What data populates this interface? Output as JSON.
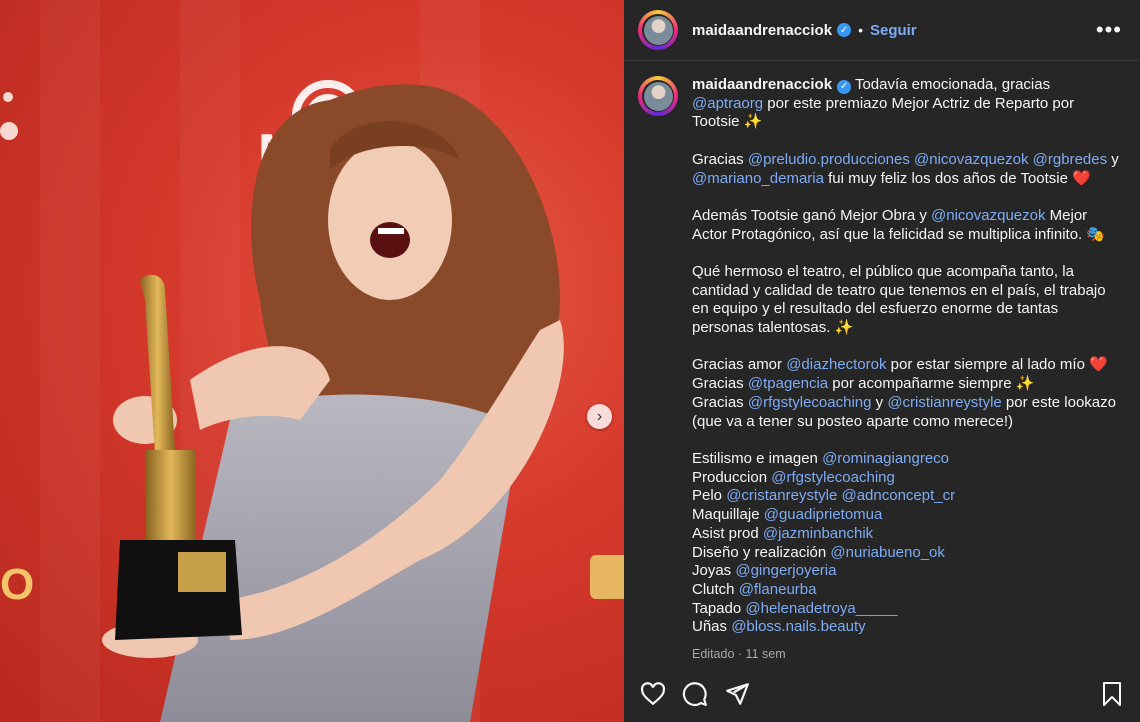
{
  "post": {
    "username": "maidaandrenacciok",
    "follow_label": "Seguir",
    "more_label": "•••",
    "next_label": "›"
  },
  "media": {
    "background_logo_text": "Ma",
    "side_logo_text": "O"
  },
  "caption": {
    "username": "maidaandrenacciok",
    "paragraphs": [
      [
        {
          "t": "Todavía emocionada, gracias "
        },
        {
          "t": "@aptraorg",
          "m": true
        },
        {
          "t": " por este premiazo Mejor Actriz de Reparto por Tootsie ✨"
        }
      ],
      [
        {
          "t": "Gracias "
        },
        {
          "t": "@preludio.producciones",
          "m": true
        },
        {
          "t": " "
        },
        {
          "t": "@nicovazquezok",
          "m": true
        },
        {
          "t": " "
        },
        {
          "t": "@rgbredes",
          "m": true
        },
        {
          "t": " y "
        },
        {
          "t": "@mariano_demaria",
          "m": true
        },
        {
          "t": " fui muy feliz los dos años de Tootsie ❤️"
        }
      ],
      [
        {
          "t": "Además Tootsie ganó Mejor Obra y "
        },
        {
          "t": "@nicovazquezok",
          "m": true
        },
        {
          "t": " Mejor Actor Protagónico, así que la felicidad se multiplica infinito. 🎭"
        }
      ],
      [
        {
          "t": "Qué hermoso el teatro, el público que acompaña tanto, la cantidad y calidad de teatro que tenemos en el país, el trabajo en equipo y el resultado del esfuerzo enorme de tantas personas talentosas. ✨"
        }
      ],
      [
        {
          "t": "Gracias amor "
        },
        {
          "t": "@diazhectorok",
          "m": true
        },
        {
          "t": " por estar siempre al lado mío ❤️"
        },
        {
          "br": true
        },
        {
          "t": "Gracias "
        },
        {
          "t": "@tpagencia",
          "m": true
        },
        {
          "t": " por acompañarme siempre ✨"
        },
        {
          "br": true
        },
        {
          "t": "Gracias "
        },
        {
          "t": "@rfgstylecoaching",
          "m": true
        },
        {
          "t": " y "
        },
        {
          "t": "@cristianreystyle",
          "m": true
        },
        {
          "t": " por este lookazo (que va a tener su posteo aparte como merece!)"
        }
      ],
      [
        {
          "t": "Estilismo e imagen "
        },
        {
          "t": "@rominagiangreco",
          "m": true
        },
        {
          "br": true
        },
        {
          "t": "Produccion "
        },
        {
          "t": "@rfgstylecoaching",
          "m": true
        },
        {
          "br": true
        },
        {
          "t": "Pelo "
        },
        {
          "t": "@cristanreystyle",
          "m": true
        },
        {
          "t": " "
        },
        {
          "t": "@adnconcept_cr",
          "m": true
        },
        {
          "br": true
        },
        {
          "t": "Maquillaje "
        },
        {
          "t": "@guadiprietomua",
          "m": true
        },
        {
          "br": true
        },
        {
          "t": "Asist prod "
        },
        {
          "t": "@jazminbanchik",
          "m": true
        },
        {
          "br": true
        },
        {
          "t": "Diseño y realización "
        },
        {
          "t": "@nuriabueno_ok",
          "m": true
        },
        {
          "br": true
        },
        {
          "t": "Joyas "
        },
        {
          "t": "@gingerjoyeria",
          "m": true
        },
        {
          "br": true
        },
        {
          "t": "Clutch "
        },
        {
          "t": "@flaneurba",
          "m": true
        },
        {
          "br": true
        },
        {
          "t": "Tapado "
        },
        {
          "t": "@helenadetroya_____",
          "m": true
        },
        {
          "br": true
        },
        {
          "t": "Uñas "
        },
        {
          "t": "@bloss.nails.beauty",
          "m": true
        }
      ]
    ],
    "edited_label": "Editado",
    "dot": "·",
    "time": "11 sem"
  },
  "icons": {
    "like": "heart-icon",
    "comment": "comment-icon",
    "share": "share-icon",
    "save": "bookmark-icon"
  },
  "colors": {
    "panel_bg": "#262626",
    "mention": "#7dacf5",
    "verified": "#3897f0",
    "photo_bg": "#d63a2c"
  }
}
